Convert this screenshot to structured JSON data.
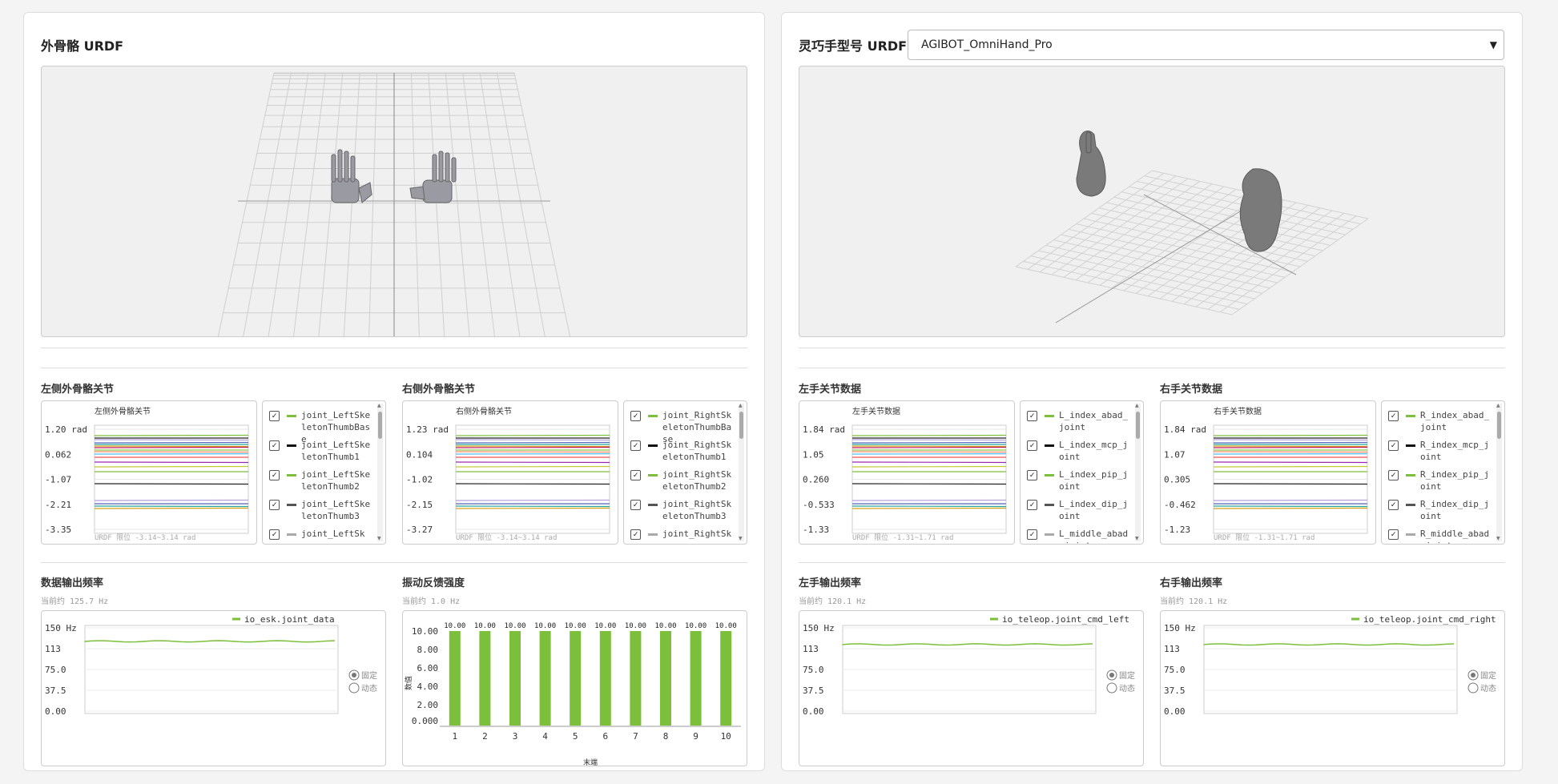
{
  "left_panel": {
    "title": "外骨骼 URDF",
    "left_joints": {
      "section_title": "左侧外骨骼关节",
      "chart_title": "左侧外骨骼关节",
      "y_ticks": [
        "1.20 rad",
        "0.062",
        "-1.07",
        "-2.21",
        "-3.35"
      ],
      "footer": "URDF 限位 -3.14~3.14 rad",
      "legend": [
        "joint_LeftSkeletonThumbBase",
        "joint_LeftSkeletonThumb1",
        "joint_LeftSkeletonThumb2",
        "joint_LeftSkeletonThumb3",
        "joint_LeftSk"
      ]
    },
    "right_joints": {
      "section_title": "右侧外骨骼关节",
      "chart_title": "右侧外骨骼关节",
      "y_ticks": [
        "1.23 rad",
        "0.104",
        "-1.02",
        "-2.15",
        "-3.27"
      ],
      "footer": "URDF 限位 -3.14~3.14 rad",
      "legend": [
        "joint_RightSkeletonThumbBase",
        "joint_RightSkeletonThumb1",
        "joint_RightSkeletonThumb2",
        "joint_RightSkeletonThumb3",
        "joint_RightSk"
      ]
    },
    "freq": {
      "section_title": "数据输出频率",
      "current": "当前约 125.7 Hz",
      "legend": "io_esk.joint_data",
      "y_ticks": [
        "150 Hz",
        "113",
        "75.0",
        "37.5",
        "0.00"
      ],
      "radio_fixed": "固定",
      "radio_dynamic": "动态"
    },
    "vib": {
      "section_title": "振动反馈强度",
      "current": "当前约 1.0 Hz",
      "y_ticks": [
        "10.00",
        "8.00",
        "6.00",
        "4.00",
        "2.00",
        "0.000"
      ],
      "ylabel": "数值",
      "xlabel": "末端",
      "x_ticks": [
        "1",
        "2",
        "3",
        "4",
        "5",
        "6",
        "7",
        "8",
        "9",
        "10"
      ],
      "bar_labels": [
        "10.00",
        "10.00",
        "10.00",
        "10.00",
        "10.00",
        "10.00",
        "10.00",
        "10.00",
        "10.00",
        "10.00"
      ]
    }
  },
  "right_panel": {
    "title": "灵巧手型号 URDF",
    "model_select": "AGIBOT_OmniHand_Pro",
    "left_hand": {
      "section_title": "左手关节数据",
      "chart_title": "左手关节数据",
      "y_ticks": [
        "1.84 rad",
        "1.05",
        "0.260",
        "-0.533",
        "-1.33"
      ],
      "footer": "URDF 限位 -1.31~1.71 rad",
      "legend": [
        "L_index_abad_joint",
        "L_index_mcp_joint",
        "L_index_pip_joint",
        "L_index_dip_joint",
        "L_middle_abad_joint"
      ]
    },
    "right_hand": {
      "section_title": "右手关节数据",
      "chart_title": "右手关节数据",
      "y_ticks": [
        "1.84 rad",
        "1.07",
        "0.305",
        "-0.462",
        "-1.23"
      ],
      "footer": "URDF 限位 -1.31~1.71 rad",
      "legend": [
        "R_index_abad_joint",
        "R_index_mcp_joint",
        "R_index_pip_joint",
        "R_index_dip_joint",
        "R_middle_abad_joint"
      ]
    },
    "left_freq": {
      "section_title": "左手输出频率",
      "current": "当前约 120.1 Hz",
      "legend": "io_teleop.joint_cmd_left",
      "y_ticks": [
        "150 Hz",
        "113",
        "75.0",
        "37.5",
        "0.00"
      ],
      "radio_fixed": "固定",
      "radio_dynamic": "动态"
    },
    "right_freq": {
      "section_title": "右手输出频率",
      "current": "当前约 120.1 Hz",
      "legend": "io_teleop.joint_cmd_right",
      "y_ticks": [
        "150 Hz",
        "113",
        "75.0",
        "37.5",
        "0.00"
      ],
      "radio_fixed": "固定",
      "radio_dynamic": "动态"
    }
  },
  "colors": {
    "accent": "#7cbf3a",
    "dark": "#111111",
    "grey": "#666666"
  },
  "chart_data": [
    {
      "type": "bar",
      "categories": [
        "1",
        "2",
        "3",
        "4",
        "5",
        "6",
        "7",
        "8",
        "9",
        "10"
      ],
      "values": [
        10,
        10,
        10,
        10,
        10,
        10,
        10,
        10,
        10,
        10
      ],
      "xlabel": "末端",
      "ylabel": "数值",
      "ylim": [
        0,
        10
      ]
    },
    {
      "type": "line",
      "series": [
        {
          "name": "io_esk.joint_data",
          "values": [
            125.7
          ]
        }
      ],
      "ylim": [
        0,
        150
      ]
    },
    {
      "type": "line",
      "series": [
        {
          "name": "io_teleop.joint_cmd_left",
          "values": [
            120.1
          ]
        }
      ],
      "ylim": [
        0,
        150
      ]
    },
    {
      "type": "line",
      "series": [
        {
          "name": "io_teleop.joint_cmd_right",
          "values": [
            120.1
          ]
        }
      ],
      "ylim": [
        0,
        150
      ]
    }
  ]
}
